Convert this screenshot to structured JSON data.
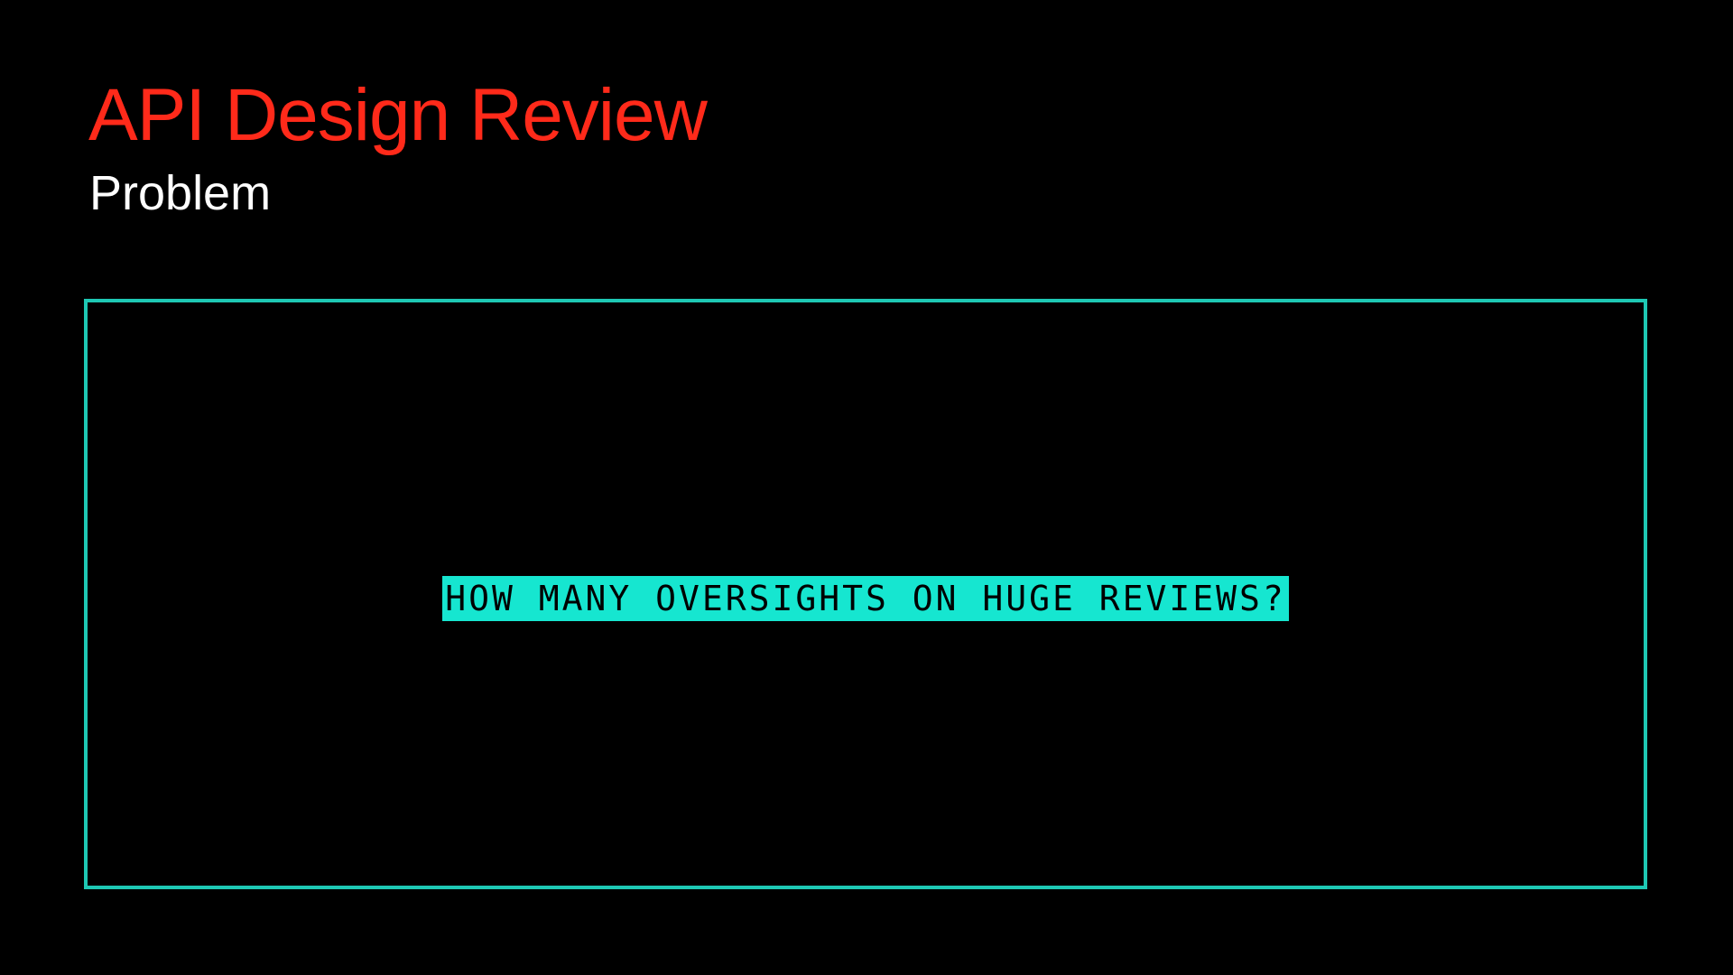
{
  "slide": {
    "title": "API Design Review",
    "subtitle": "Problem",
    "callout": "HOW MANY OVERSIGHTS ON HUGE REVIEWS?"
  },
  "colors": {
    "background": "#000000",
    "title": "#ff2a1a",
    "subtitle": "#ffffff",
    "frame_border": "#1ec8b4",
    "callout_background": "#16e6d0",
    "callout_text": "#000000"
  }
}
